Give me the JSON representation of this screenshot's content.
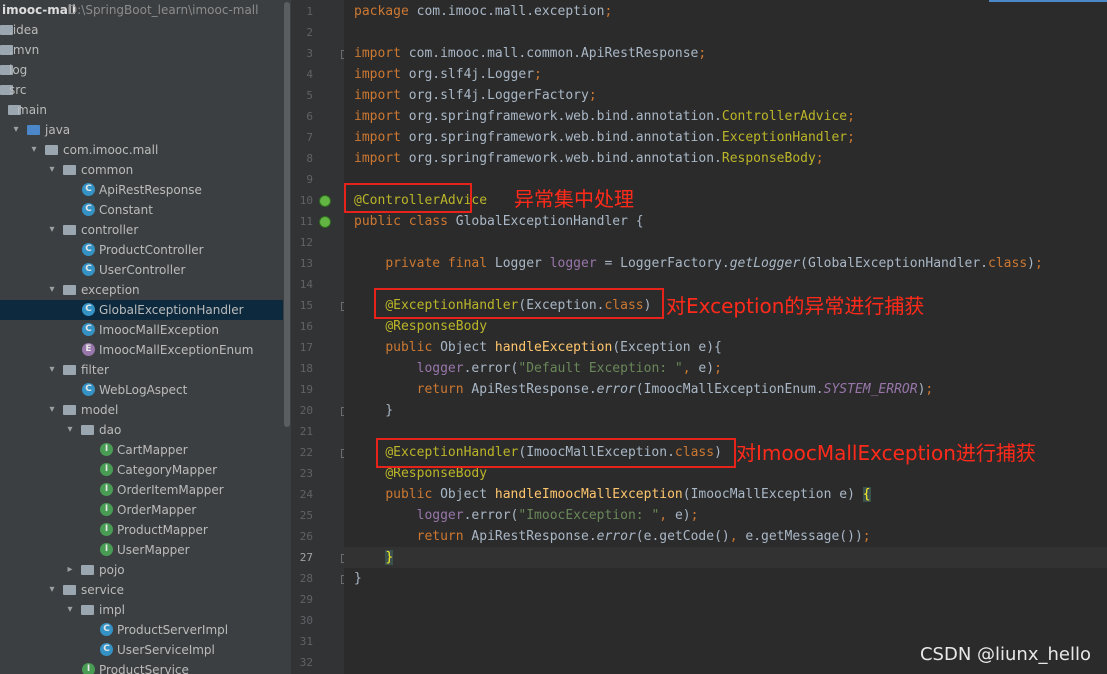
{
  "project": {
    "name": "imooc-mall",
    "path": "D:\\SpringBoot_learn\\imooc-mall"
  },
  "tree": [
    {
      "label": ".idea",
      "type": "folder",
      "depth": 0,
      "expanded": null
    },
    {
      "label": ".mvn",
      "type": "folder",
      "depth": 0,
      "expanded": null
    },
    {
      "label": "log",
      "type": "folder",
      "depth": 0,
      "expanded": null
    },
    {
      "label": "src",
      "type": "folder",
      "depth": 0,
      "expanded": null
    },
    {
      "label": "main",
      "type": "folder",
      "depth": 1,
      "expanded": null
    },
    {
      "label": "java",
      "type": "src-folder",
      "depth": 2,
      "expanded": true
    },
    {
      "label": "com.imooc.mall",
      "type": "package",
      "depth": 3,
      "expanded": true
    },
    {
      "label": "common",
      "type": "package",
      "depth": 4,
      "expanded": true
    },
    {
      "label": "ApiRestResponse",
      "type": "C",
      "depth": 5
    },
    {
      "label": "Constant",
      "type": "C",
      "depth": 5
    },
    {
      "label": "controller",
      "type": "package",
      "depth": 4,
      "expanded": true
    },
    {
      "label": "ProductController",
      "type": "C",
      "depth": 5
    },
    {
      "label": "UserController",
      "type": "C",
      "depth": 5
    },
    {
      "label": "exception",
      "type": "package",
      "depth": 4,
      "expanded": true
    },
    {
      "label": "GlobalExceptionHandler",
      "type": "C",
      "depth": 5,
      "selected": true
    },
    {
      "label": "ImoocMallException",
      "type": "C",
      "depth": 5
    },
    {
      "label": "ImoocMallExceptionEnum",
      "type": "E",
      "depth": 5
    },
    {
      "label": "filter",
      "type": "package",
      "depth": 4,
      "expanded": true
    },
    {
      "label": "WebLogAspect",
      "type": "C",
      "depth": 5
    },
    {
      "label": "model",
      "type": "package",
      "depth": 4,
      "expanded": true
    },
    {
      "label": "dao",
      "type": "package",
      "depth": 5,
      "expanded": true
    },
    {
      "label": "CartMapper",
      "type": "I",
      "depth": 6
    },
    {
      "label": "CategoryMapper",
      "type": "I",
      "depth": 6
    },
    {
      "label": "OrderItemMapper",
      "type": "I",
      "depth": 6
    },
    {
      "label": "OrderMapper",
      "type": "I",
      "depth": 6
    },
    {
      "label": "ProductMapper",
      "type": "I",
      "depth": 6
    },
    {
      "label": "UserMapper",
      "type": "I",
      "depth": 6
    },
    {
      "label": "pojo",
      "type": "package",
      "depth": 5,
      "expanded": false
    },
    {
      "label": "service",
      "type": "package",
      "depth": 4,
      "expanded": true
    },
    {
      "label": "impl",
      "type": "package",
      "depth": 5,
      "expanded": true
    },
    {
      "label": "ProductServerImpl",
      "type": "C",
      "depth": 6
    },
    {
      "label": "UserServiceImpl",
      "type": "C",
      "depth": 6
    },
    {
      "label": "ProductService",
      "type": "I",
      "depth": 5
    }
  ],
  "editor": {
    "current_line": 27,
    "lines": [
      [
        [
          "kw",
          "package "
        ],
        [
          "t",
          "com.imooc.mall.exception"
        ],
        [
          "kw",
          ";"
        ]
      ],
      [],
      [
        [
          "kw",
          "import "
        ],
        [
          "t",
          "com.imooc.mall.common.ApiRestResponse"
        ],
        [
          "kw",
          ";"
        ]
      ],
      [
        [
          "kw",
          "import "
        ],
        [
          "t",
          "org.slf4j.Logger"
        ],
        [
          "kw",
          ";"
        ]
      ],
      [
        [
          "kw",
          "import "
        ],
        [
          "t",
          "org.slf4j.LoggerFactory"
        ],
        [
          "kw",
          ";"
        ]
      ],
      [
        [
          "kw",
          "import "
        ],
        [
          "t",
          "org.springframework.web.bind.annotation."
        ],
        [
          "ann",
          "ControllerAdvice"
        ],
        [
          "kw",
          ";"
        ]
      ],
      [
        [
          "kw",
          "import "
        ],
        [
          "t",
          "org.springframework.web.bind.annotation."
        ],
        [
          "ann",
          "ExceptionHandler"
        ],
        [
          "kw",
          ";"
        ]
      ],
      [
        [
          "kw",
          "import "
        ],
        [
          "t",
          "org.springframework.web.bind.annotation."
        ],
        [
          "ann",
          "ResponseBody"
        ],
        [
          "kw",
          ";"
        ]
      ],
      [],
      [
        [
          "ann",
          "@ControllerAdvice"
        ]
      ],
      [
        [
          "kw",
          "public class "
        ],
        [
          "t",
          "GlobalExceptionHandler {"
        ]
      ],
      [],
      [
        [
          "t",
          "    "
        ],
        [
          "kw",
          "private final "
        ],
        [
          "t",
          "Logger "
        ],
        [
          "fld",
          "logger "
        ],
        [
          "t",
          "= LoggerFactory."
        ],
        [
          "it",
          "getLogger"
        ],
        [
          "t",
          "(GlobalExceptionHandler."
        ],
        [
          "kw",
          "class"
        ],
        [
          "t",
          ")"
        ],
        [
          "kw",
          ";"
        ]
      ],
      [],
      [
        [
          "t",
          "    "
        ],
        [
          "ann",
          "@ExceptionHandler"
        ],
        [
          "t",
          "(Exception."
        ],
        [
          "kw",
          "class"
        ],
        [
          "t",
          ")"
        ]
      ],
      [
        [
          "t",
          "    "
        ],
        [
          "ann",
          "@ResponseBody"
        ]
      ],
      [
        [
          "t",
          "    "
        ],
        [
          "kw",
          "public "
        ],
        [
          "t",
          "Object "
        ],
        [
          "fn",
          "handleException"
        ],
        [
          "t",
          "(Exception e){"
        ]
      ],
      [
        [
          "t",
          "        "
        ],
        [
          "fld",
          "logger"
        ],
        [
          "t",
          ".error("
        ],
        [
          "str",
          "\"Default Exception: \""
        ],
        [
          "kw",
          ", "
        ],
        [
          "t",
          "e)"
        ],
        [
          "kw",
          ";"
        ]
      ],
      [
        [
          "t",
          "        "
        ],
        [
          "kw",
          "return "
        ],
        [
          "t",
          "ApiRestResponse."
        ],
        [
          "it",
          "error"
        ],
        [
          "t",
          "(ImoocMallExceptionEnum."
        ],
        [
          "static",
          "SYSTEM_ERROR"
        ],
        [
          "t",
          ")"
        ],
        [
          "kw",
          ";"
        ]
      ],
      [
        [
          "t",
          "    }"
        ]
      ],
      [],
      [
        [
          "t",
          "    "
        ],
        [
          "ann",
          "@ExceptionHandler"
        ],
        [
          "t",
          "(ImoocMallException."
        ],
        [
          "kw",
          "class"
        ],
        [
          "t",
          ")"
        ]
      ],
      [
        [
          "t",
          "    "
        ],
        [
          "ann",
          "@ResponseBody"
        ]
      ],
      [
        [
          "t",
          "    "
        ],
        [
          "kw",
          "public "
        ],
        [
          "t",
          "Object "
        ],
        [
          "fn",
          "handleImoocMallException"
        ],
        [
          "t",
          "(ImoocMallException e) "
        ],
        [
          "brace",
          "{"
        ]
      ],
      [
        [
          "t",
          "        "
        ],
        [
          "fld",
          "logger"
        ],
        [
          "t",
          ".error("
        ],
        [
          "str",
          "\"ImoocException: \""
        ],
        [
          "kw",
          ", "
        ],
        [
          "t",
          "e)"
        ],
        [
          "kw",
          ";"
        ]
      ],
      [
        [
          "t",
          "        "
        ],
        [
          "kw",
          "return "
        ],
        [
          "t",
          "ApiRestResponse."
        ],
        [
          "it",
          "error"
        ],
        [
          "t",
          "(e.getCode()"
        ],
        [
          "kw",
          ", "
        ],
        [
          "t",
          "e.getMessage())"
        ],
        [
          "kw",
          ";"
        ]
      ],
      [
        [
          "t",
          "    "
        ],
        [
          "brace",
          "}"
        ]
      ],
      [
        [
          "t",
          "}"
        ]
      ],
      [],
      [],
      [],
      []
    ]
  },
  "annotations": [
    {
      "text": "异常集中处理"
    },
    {
      "text": "对Exception的异常进行捕获"
    },
    {
      "text": "对ImoocMallException进行捕获"
    }
  ],
  "watermark": "CSDN @liunx_hello",
  "colors": {
    "keyword": "#cc7832",
    "annotation": "#bbb529",
    "string": "#6a8759",
    "field": "#9876aa",
    "method": "#ffc66d",
    "highlight_box": "#e5231a"
  }
}
